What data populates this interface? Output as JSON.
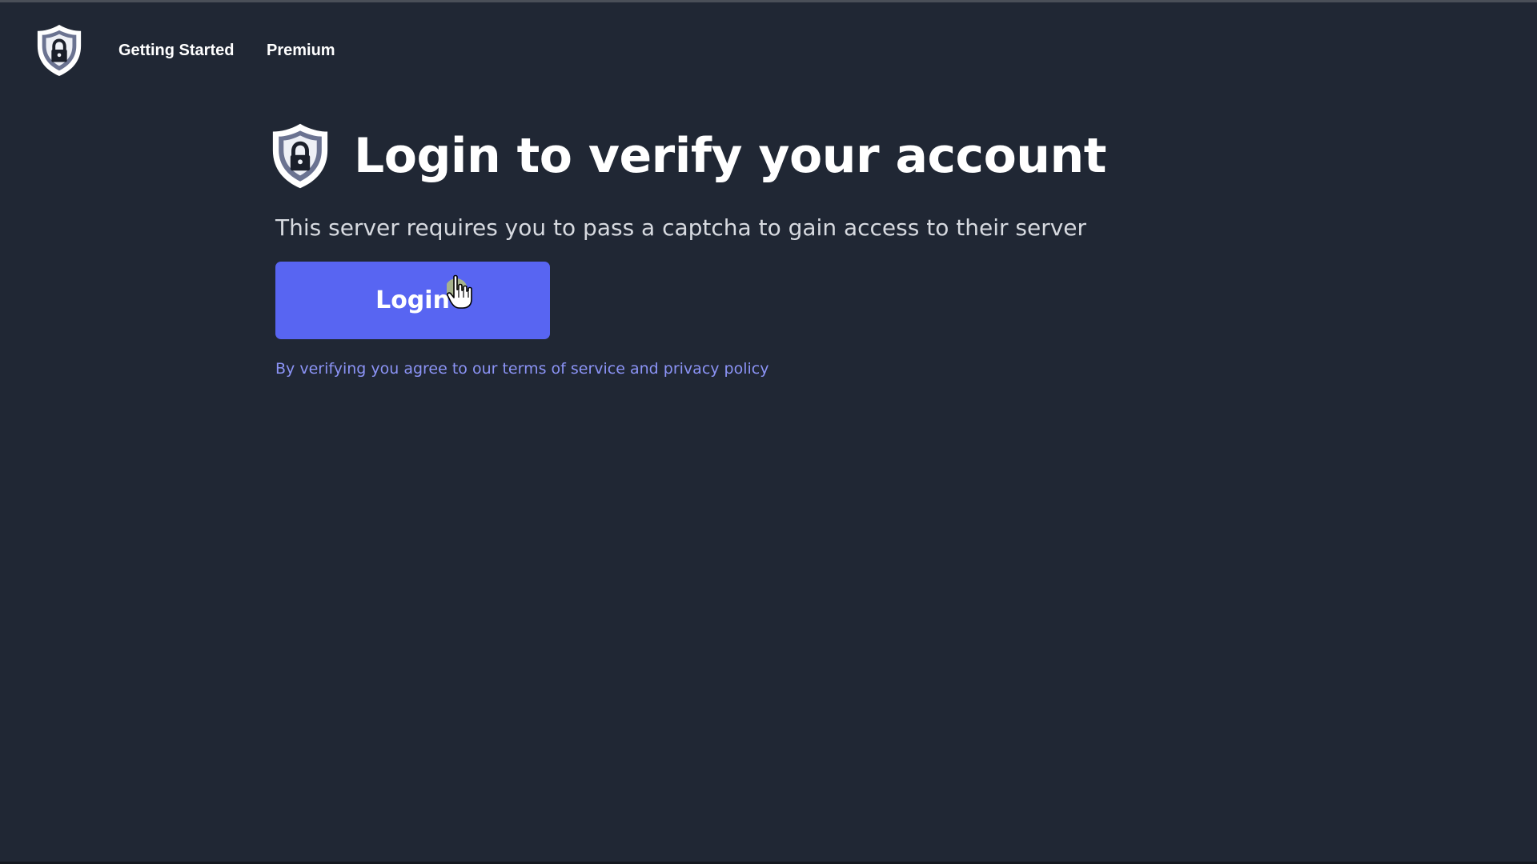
{
  "colors": {
    "background": "#202734",
    "accent": "#5865f2",
    "link": "#8b93f5",
    "text": "#ffffff",
    "subtext": "#d7dae0"
  },
  "navbar": {
    "logo_icon": "shield-lock-icon",
    "links": [
      {
        "label": "Getting Started"
      },
      {
        "label": "Premium"
      }
    ]
  },
  "main": {
    "title_icon": "shield-lock-icon",
    "title": "Login to verify your account",
    "subtitle": "This server requires you to pass a captcha to gain access to their server",
    "login_label": "Login",
    "legal": {
      "prefix": "By verifying you agree to our ",
      "terms": "terms of service",
      "conjunction": " and ",
      "privacy": "privacy policy"
    }
  },
  "cursor": "hand-pointer-icon"
}
